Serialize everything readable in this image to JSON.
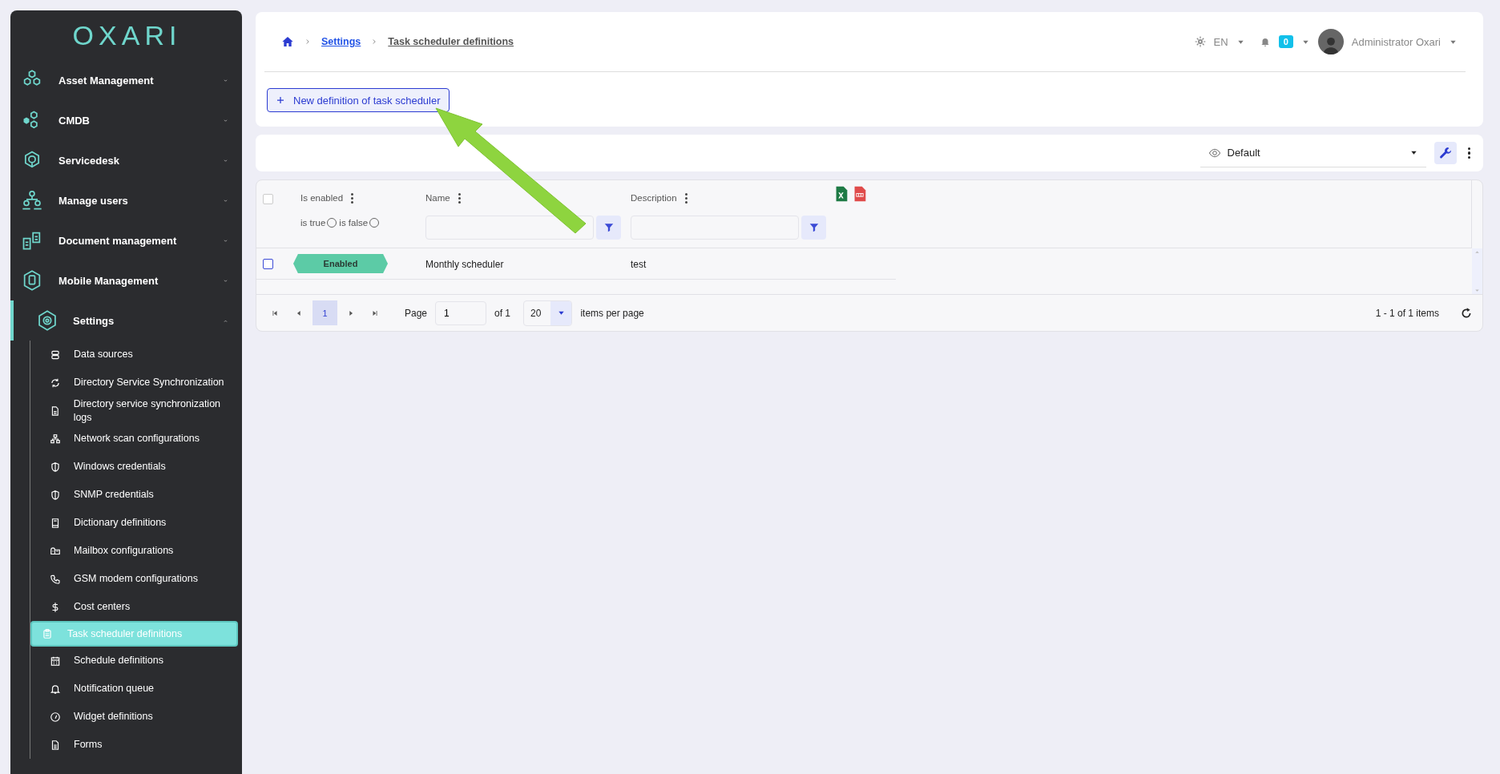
{
  "logo": "OXARI",
  "sidebar": {
    "items": [
      {
        "label": "Asset Management",
        "expanded": false
      },
      {
        "label": "CMDB",
        "expanded": false
      },
      {
        "label": "Servicedesk",
        "expanded": false
      },
      {
        "label": "Manage users",
        "expanded": false
      },
      {
        "label": "Document management",
        "expanded": false
      },
      {
        "label": "Mobile Management",
        "expanded": false
      },
      {
        "label": "Settings",
        "expanded": true,
        "children": [
          {
            "label": "Data sources",
            "selected": false
          },
          {
            "label": "Directory Service Synchronization",
            "selected": false
          },
          {
            "label": "Directory service synchronization logs",
            "selected": false
          },
          {
            "label": "Network scan configurations",
            "selected": false
          },
          {
            "label": "Windows credentials",
            "selected": false
          },
          {
            "label": "SNMP credentials",
            "selected": false
          },
          {
            "label": "Dictionary definitions",
            "selected": false
          },
          {
            "label": "Mailbox configurations",
            "selected": false
          },
          {
            "label": "GSM modem configurations",
            "selected": false
          },
          {
            "label": "Cost centers",
            "selected": false
          },
          {
            "label": "Task scheduler definitions",
            "selected": true
          },
          {
            "label": "Schedule definitions",
            "selected": false
          },
          {
            "label": "Notification queue",
            "selected": false
          },
          {
            "label": "Widget definitions",
            "selected": false
          },
          {
            "label": "Forms",
            "selected": false
          }
        ]
      }
    ]
  },
  "breadcrumb": [
    {
      "label": "Settings",
      "link": true
    },
    {
      "label": "Task scheduler definitions",
      "link": false
    }
  ],
  "header": {
    "language": "EN",
    "notifications": "0",
    "user": "Administrator Oxari"
  },
  "new_button": "New definition of task scheduler",
  "view_select": "Default",
  "table": {
    "columns": [
      {
        "label": "Is enabled",
        "kind": "radio",
        "options": [
          {
            "label": "is true",
            "checked": false
          },
          {
            "label": "is false",
            "checked": false
          }
        ]
      },
      {
        "label": "Name",
        "kind": "text"
      },
      {
        "label": "Description",
        "kind": "text"
      }
    ],
    "all_selected": false,
    "rows": [
      {
        "selected": false,
        "enabled": true,
        "status": "Enabled",
        "name": "Monthly scheduler",
        "description": "test"
      }
    ]
  },
  "pagination": {
    "current": "1",
    "page_label": "Page",
    "page_input": "1",
    "of": "of 1",
    "page_size": "20",
    "size_label": "items per page",
    "summary": "1 - 1 of 1 items"
  }
}
